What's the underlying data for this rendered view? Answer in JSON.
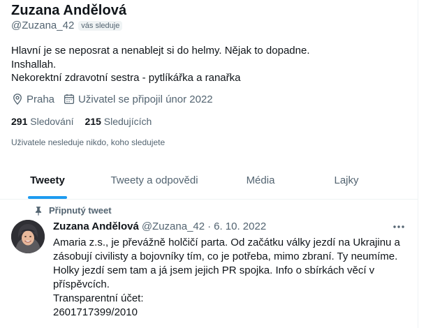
{
  "profile": {
    "name": "Zuzana Andělová",
    "handle": "@Zuzana_42",
    "follows_you_badge": "vás sleduje",
    "bio_lines": [
      "Hlavní je se neposrat a nenablejt si do helmy. Nějak to dopadne.",
      "Inshallah.",
      "Nekorektní zdravotní sestra - pytlíkářka a ranařka"
    ],
    "location": "Praha",
    "location_icon": "location-pin-icon",
    "joined": "Uživatel se připojil únor 2022",
    "joined_icon": "calendar-icon",
    "following_count": "291",
    "following_label": "Sledování",
    "followers_count": "215",
    "followers_label": "Sledujících",
    "not_followed_note": "Uživatele nesleduje nikdo, koho sledujete"
  },
  "tabs": [
    {
      "label": "Tweety",
      "active": true
    },
    {
      "label": "Tweety a odpovědi",
      "active": false
    },
    {
      "label": "Média",
      "active": false
    },
    {
      "label": "Lajky",
      "active": false
    }
  ],
  "pinned_tweet": {
    "pinned_label": "Připnutý tweet",
    "pinned_icon": "pin-icon",
    "author_name": "Zuzana Andělová",
    "author_handle": "@Zuzana_42",
    "separator": "·",
    "date": "6. 10. 2022",
    "more_icon": "more-dots-icon",
    "text_lines": [
      "Amaria z.s., je převážně holčičí parta. Od začátku války jezdí na Ukrajinu a",
      "zásobují civilisty a bojovníky tím, co je potřeba, mimo zbraní. Ty neumíme.",
      "Holky jezdí sem tam a já jsem jejich PR spojka. Info o sbírkách věcí v",
      "příspěvcích.",
      "Transparentní účet:",
      "2601717399/2010"
    ]
  },
  "colors": {
    "accent": "#1d9bf0",
    "text_primary": "#0f1419",
    "text_secondary": "#536471",
    "divider": "#eff3f4"
  }
}
